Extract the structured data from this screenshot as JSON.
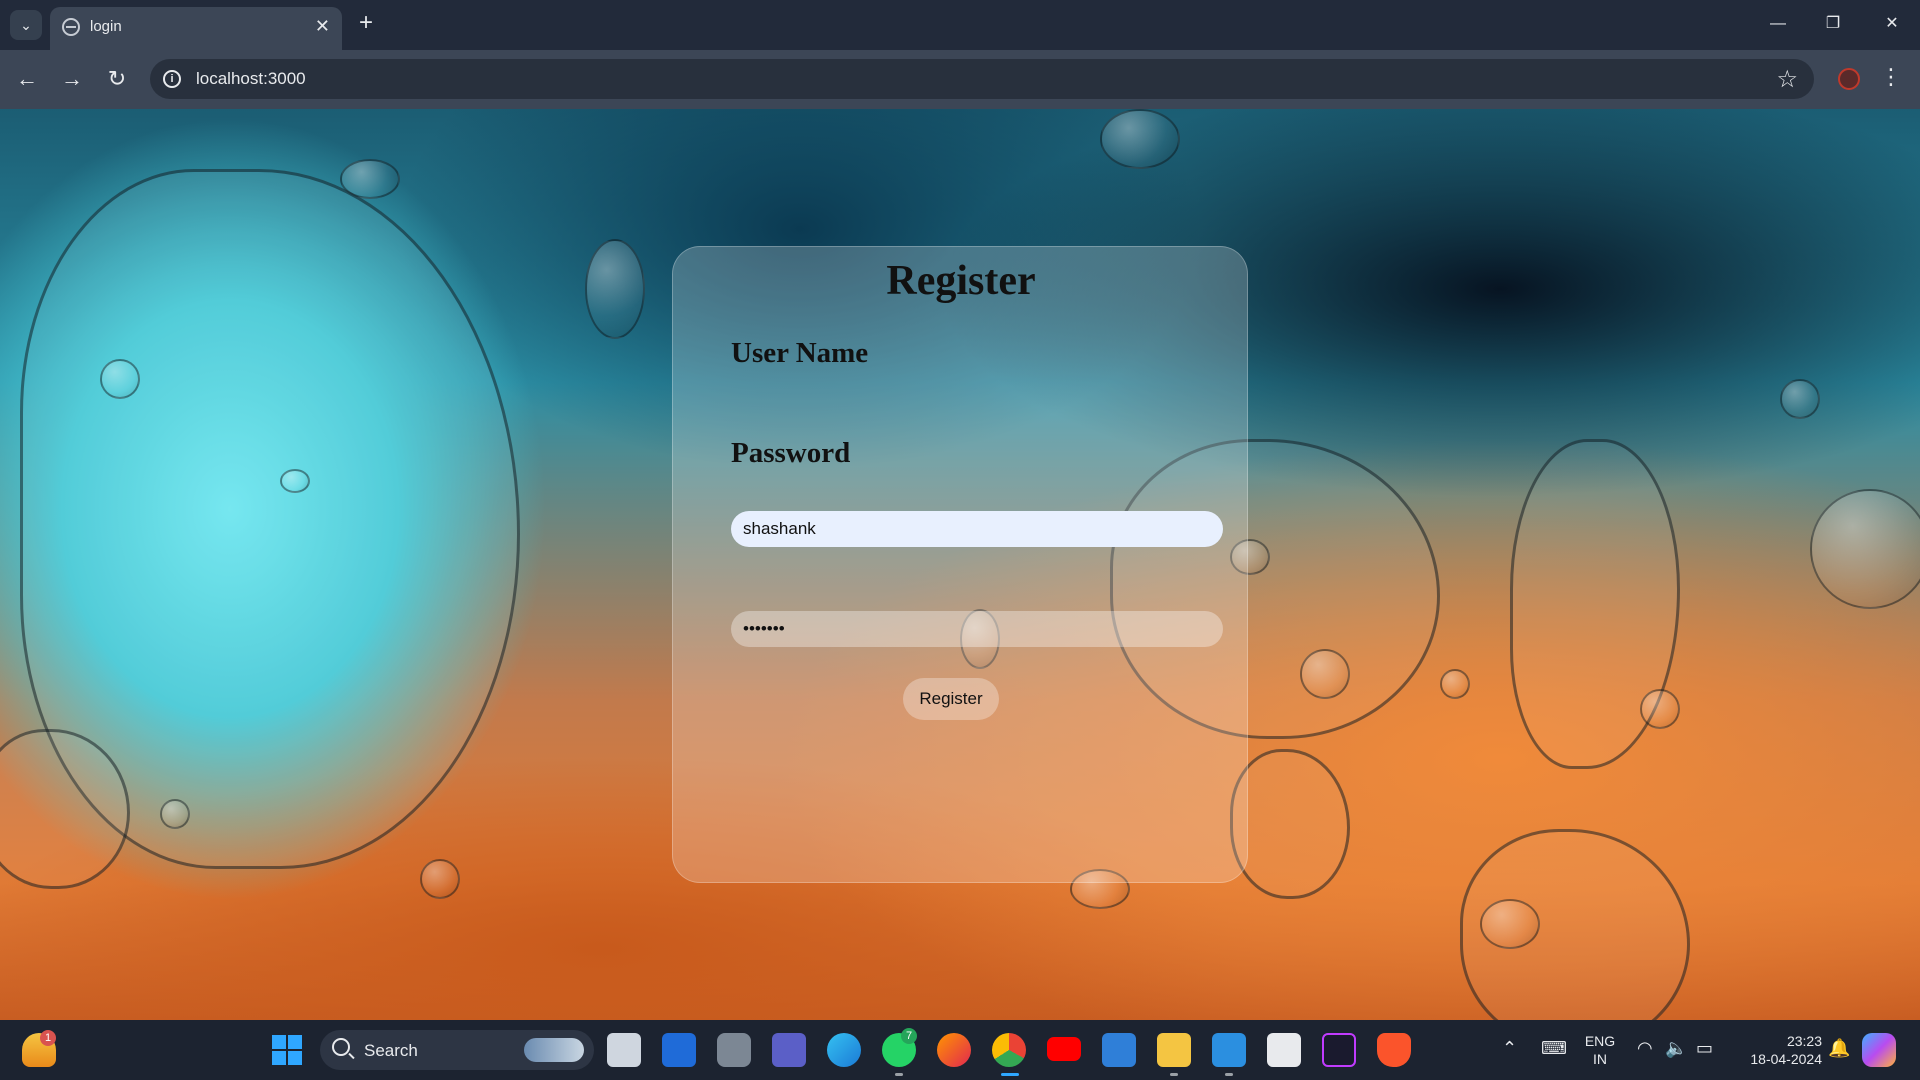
{
  "browser": {
    "tab_title": "login",
    "url": "localhost:3000"
  },
  "form": {
    "title": "Register",
    "username_label": "User Name",
    "username_value": "shashank",
    "password_label": "Password",
    "password_value": "•••••••",
    "submit_label": "Register"
  },
  "taskbar": {
    "search_placeholder": "Search",
    "notification_badge": "1",
    "whatsapp_badge": "7",
    "lang_line1": "ENG",
    "lang_line2": "IN",
    "time": "23:23",
    "date": "18-04-2024"
  },
  "colors": {
    "accent_blue": "#2fa7ff",
    "tab_active": "#3c4656",
    "tabstrip": "#222a3a"
  }
}
